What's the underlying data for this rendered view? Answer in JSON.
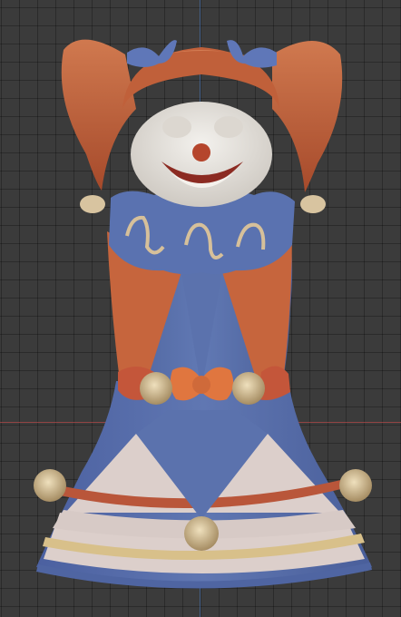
{
  "viewport": {
    "background": "#3b3b3b",
    "grid_color": "#2e2e2e",
    "axis_x_color": "#b04848",
    "axis_y_color": "#4f7fc8"
  },
  "model": {
    "subject": "clown-doll",
    "colors": {
      "hair": "#c0603a",
      "bow": "#5f77b8",
      "face": "#ece9e3",
      "nose": "#b5452c",
      "mouth": "#8c2b22",
      "body_blue": "#5b72ad",
      "panel_orange": "#c6653d",
      "skirt_pink": "#dccfcb",
      "stripe_orange": "#b9563a",
      "stripe_cream": "#d8c08a",
      "pompom": "#d8c4a0"
    }
  }
}
